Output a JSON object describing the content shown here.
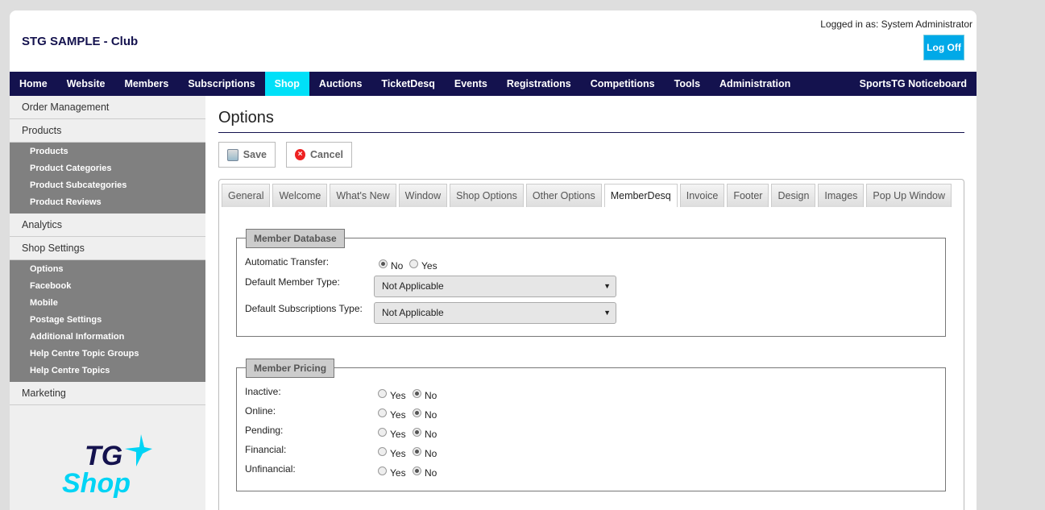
{
  "header": {
    "title": "STG SAMPLE - Club",
    "logged_in": "Logged in as: System Administrator",
    "log_off": "Log Off"
  },
  "nav": [
    "Home",
    "Website",
    "Members",
    "Subscriptions",
    "Shop",
    "Auctions",
    "TicketDesq",
    "Events",
    "Registrations",
    "Competitions",
    "Tools",
    "Administration"
  ],
  "nav_right": "SportsTG Noticeboard",
  "sidebar": {
    "order": "Order Management",
    "products": "Products",
    "product_items": [
      "Products",
      "Product Categories",
      "Product Subcategories",
      "Product Reviews"
    ],
    "analytics": "Analytics",
    "shop_settings": "Shop Settings",
    "settings_items": [
      "Options",
      "Facebook",
      "Mobile",
      "Postage Settings",
      "Additional Information",
      "Help Centre Topic Groups",
      "Help Centre Topics"
    ],
    "marketing": "Marketing",
    "logo_text": "TG Shop"
  },
  "page": {
    "title": "Options",
    "save": "Save",
    "cancel": "Cancel"
  },
  "tabs": [
    "General",
    "Welcome",
    "What's New",
    "Window",
    "Shop Options",
    "Other Options",
    "MemberDesq",
    "Invoice",
    "Footer",
    "Design",
    "Images",
    "Pop Up Window"
  ],
  "member_db": {
    "legend": "Member Database",
    "auto_label": "Automatic Transfer:",
    "no": "No",
    "yes": "Yes",
    "auto_value": "No",
    "member_type_label": "Default Member Type:",
    "member_type": "Not Applicable",
    "subs_type_label": "Default Subscriptions Type:",
    "subs_type": "Not Applicable"
  },
  "pricing": {
    "legend": "Member Pricing",
    "yes": "Yes",
    "no": "No",
    "rows": [
      {
        "label": "Inactive:",
        "value": "No"
      },
      {
        "label": "Online:",
        "value": "No"
      },
      {
        "label": "Pending:",
        "value": "No"
      },
      {
        "label": "Financial:",
        "value": "No"
      },
      {
        "label": "Unfinancial:",
        "value": "No"
      }
    ]
  }
}
